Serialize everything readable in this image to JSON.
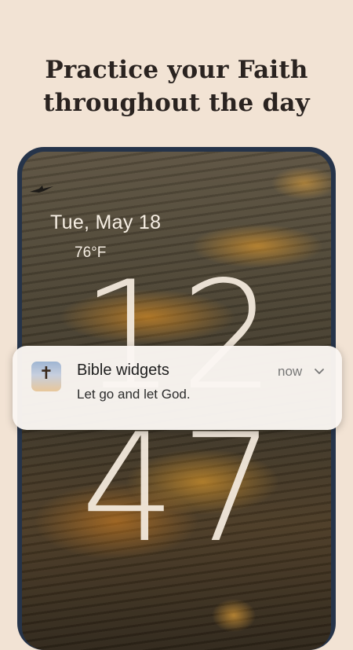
{
  "headline": {
    "line1": "Practice your Faith",
    "line2": "throughout the day"
  },
  "lockscreen": {
    "date": "Tue, May 18",
    "temperature": "76°F",
    "clock_hours": "12",
    "clock_minutes": "47"
  },
  "notification": {
    "app_name": "Bible widgets",
    "time": "now",
    "message": "Let go and let God.",
    "icon": "cross-icon",
    "expand_icon": "chevron-down-icon"
  },
  "colors": {
    "background": "#f2e3d4",
    "phone_frame": "#26344a",
    "headline": "#2a2320"
  }
}
